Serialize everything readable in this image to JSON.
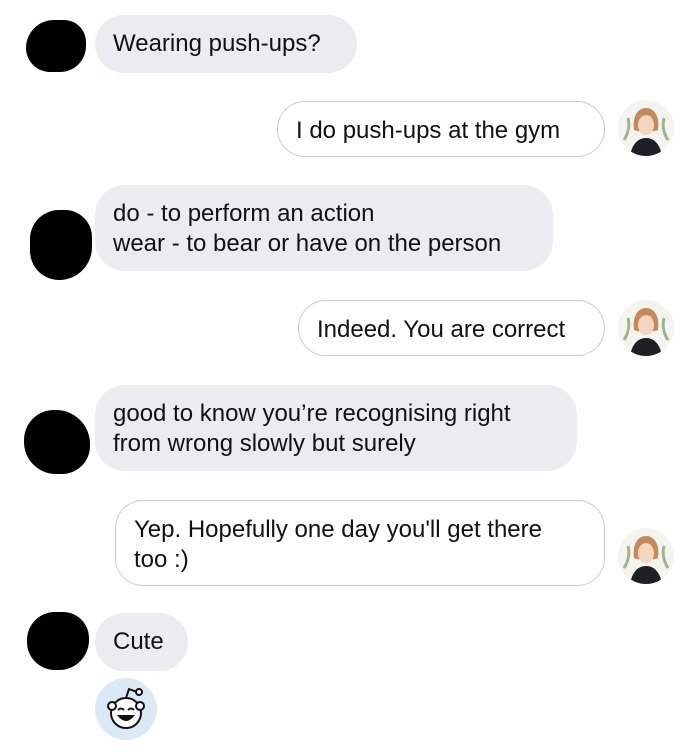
{
  "messages": [
    {
      "sender": "other",
      "text": "Wearing push-ups?"
    },
    {
      "sender": "me",
      "text": "I do push-ups at the gym"
    },
    {
      "sender": "other",
      "text": "do - to perform an action\nwear - to bear or have on the person"
    },
    {
      "sender": "me",
      "text": "Indeed. You are correct"
    },
    {
      "sender": "other",
      "text": "good to know you’re recognising right\nfrom wrong slowly but surely"
    },
    {
      "sender": "me",
      "text": "Yep. Hopefully one day you'll get there\ntoo :)"
    },
    {
      "sender": "other",
      "text": "Cute"
    }
  ],
  "reaction": {
    "icon": "snoo-laughing-icon"
  },
  "colors": {
    "incoming_bubble": "#e9edf0",
    "outgoing_border": "#c9cdd2",
    "redaction": "#000000",
    "reaction_bg": "#dbe9f6"
  }
}
